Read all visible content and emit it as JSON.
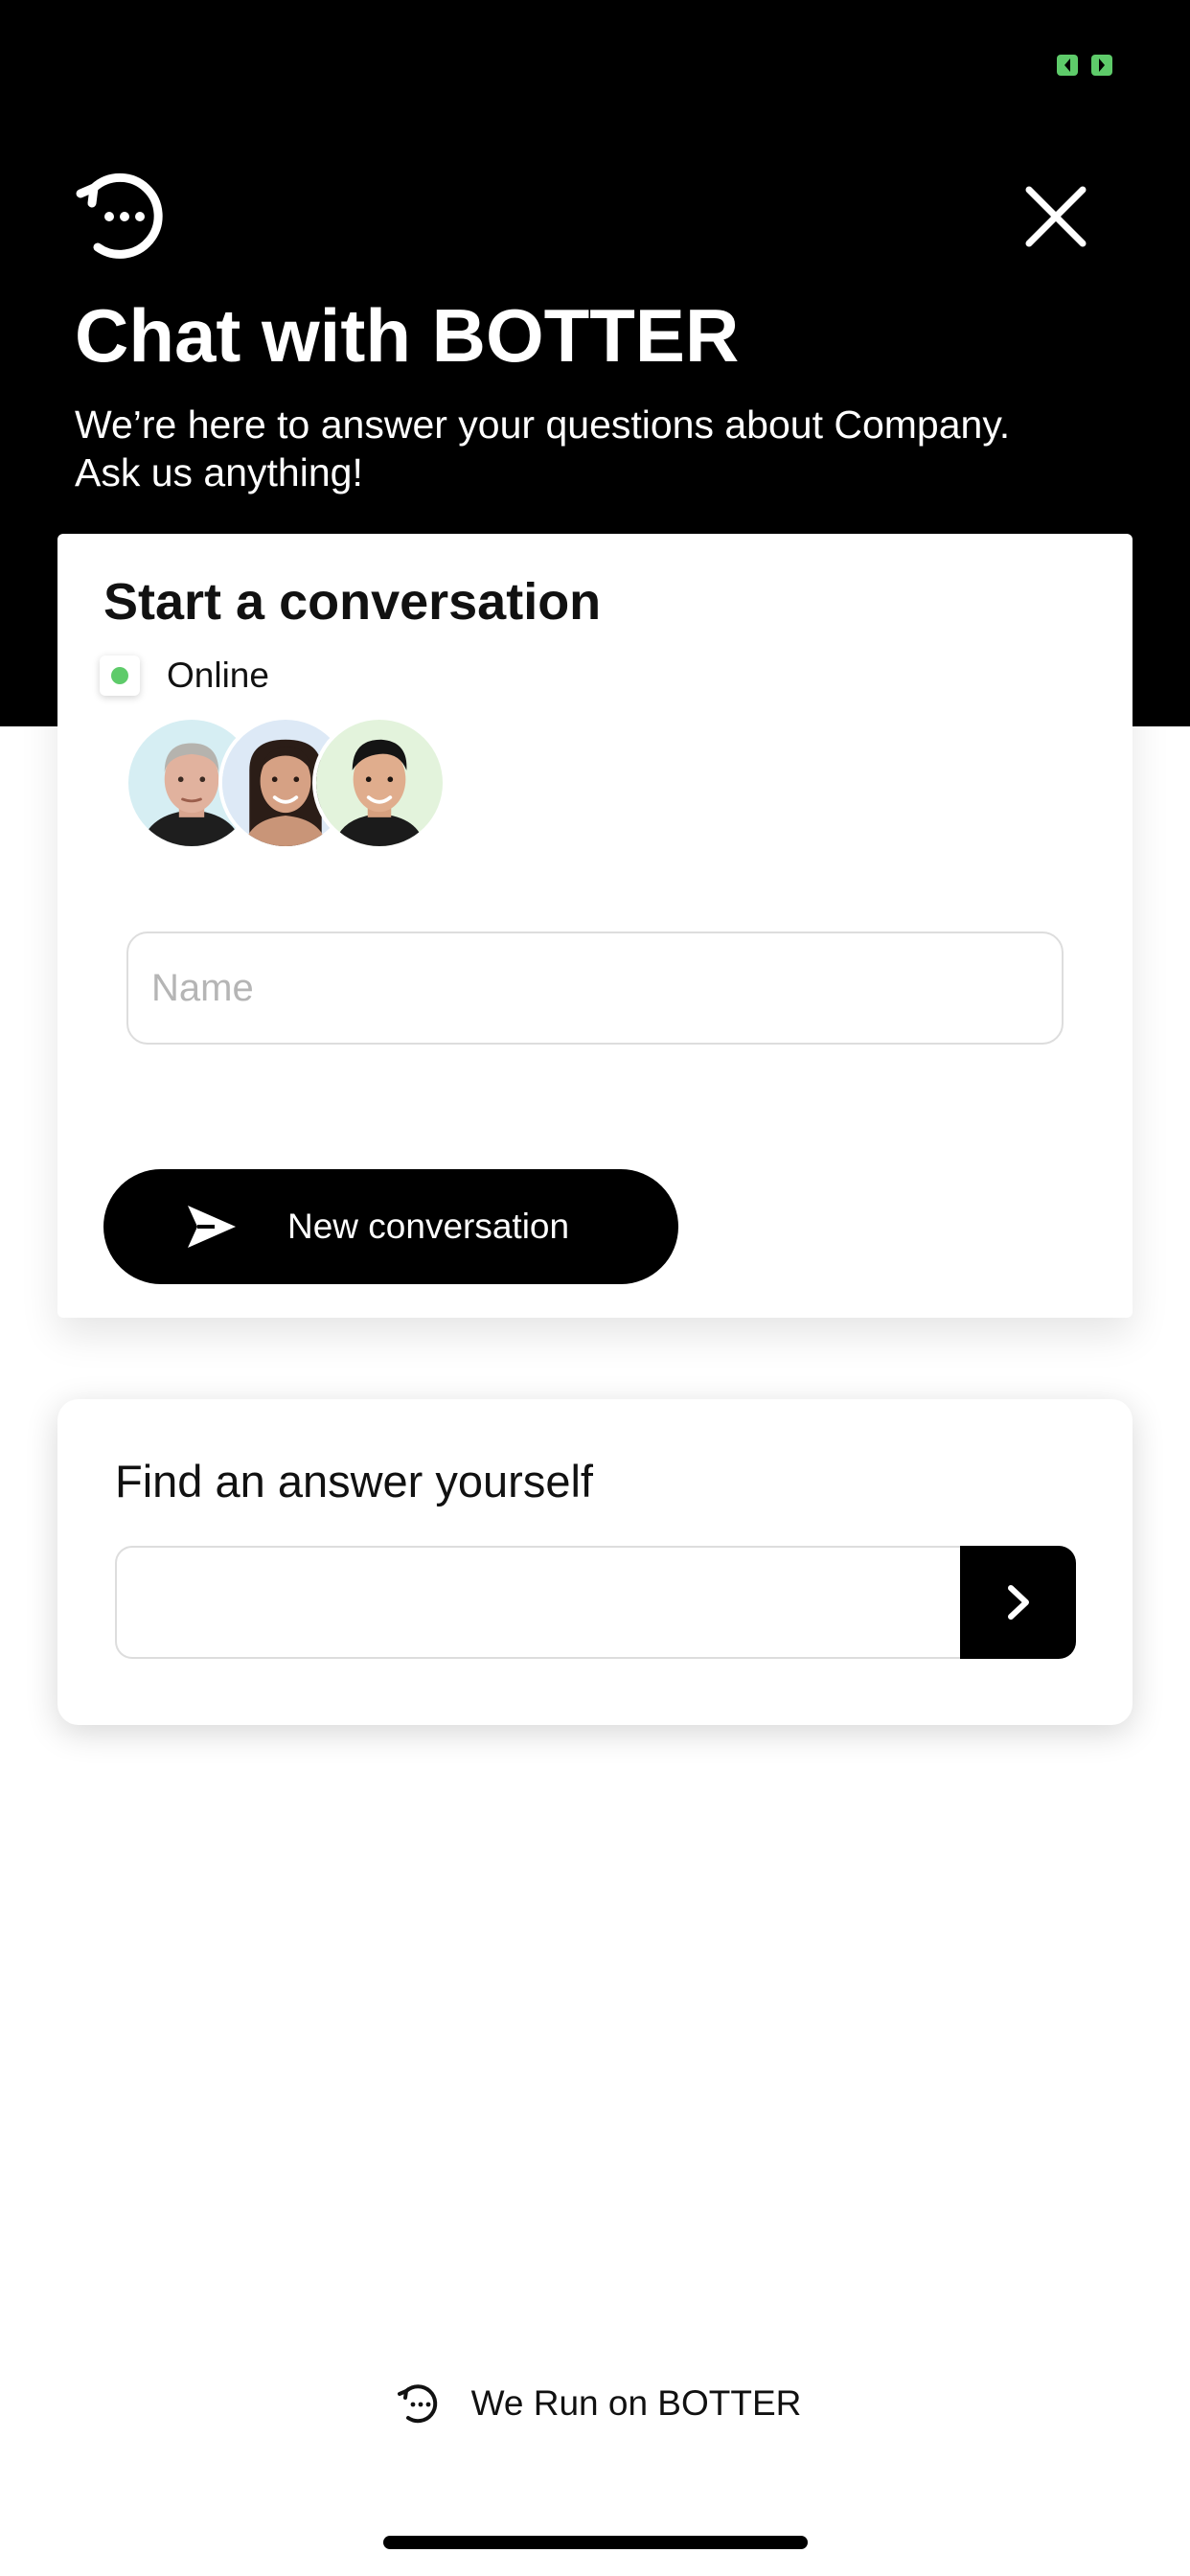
{
  "header": {
    "title": "Chat with BOTTER",
    "subtitle_lines": [
      "We’re here to answer your questions about Company.",
      "Ask us anything!"
    ]
  },
  "start_conversation": {
    "title": "Start a conversation",
    "status_label": "Online",
    "status_color": "#5ecb6a",
    "name_placeholder": "Name",
    "name_value": "",
    "button_label": "New conversation"
  },
  "find_answer": {
    "title": "Find an answer yourself",
    "search_value": ""
  },
  "footer": {
    "powered_label": "We Run on BOTTER"
  },
  "icons": {
    "brand": "chat-dots-logo-icon",
    "close": "close-icon",
    "send": "send-icon",
    "submit": "chevron-right-icon",
    "battery": "battery-icon"
  },
  "colors": {
    "header_bg": "#000000",
    "accent": "#000000",
    "online": "#5ecb6a",
    "battery": "#5ecb6a"
  }
}
